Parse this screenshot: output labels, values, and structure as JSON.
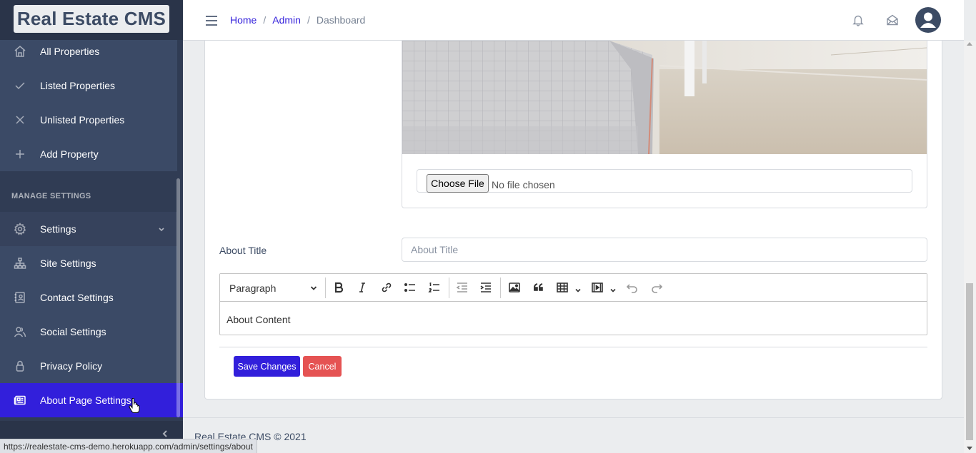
{
  "brand": "Real Estate CMS",
  "sidebar": {
    "items": [
      {
        "label": "All Properties",
        "icon": "home-icon"
      },
      {
        "label": "Listed Properties",
        "icon": "check-icon"
      },
      {
        "label": "Unlisted Properties",
        "icon": "x-icon"
      },
      {
        "label": "Add Property",
        "icon": "plus-icon"
      }
    ],
    "section_title": "MANAGE SETTINGS",
    "settings": [
      {
        "label": "Settings",
        "icon": "gear-icon"
      },
      {
        "label": "Site Settings",
        "icon": "sitemap-icon"
      },
      {
        "label": "Contact Settings",
        "icon": "contact-icon"
      },
      {
        "label": "Social Settings",
        "icon": "people-icon"
      },
      {
        "label": "Privacy Policy",
        "icon": "lock-icon"
      },
      {
        "label": "About Page Settings",
        "icon": "newspaper-icon"
      }
    ]
  },
  "header": {
    "breadcrumb": [
      "Home",
      "Admin",
      "Dashboard"
    ]
  },
  "form": {
    "file_button": "Choose File",
    "file_status": "No file chosen",
    "about_title_label": "About Title",
    "about_title_placeholder": "About Title",
    "editor_format": "Paragraph",
    "editor_content": "About Content",
    "save_label": "Save Changes",
    "cancel_label": "Cancel"
  },
  "footer": {
    "text": "Real Estate CMS © 2021"
  },
  "status_url": "https://realestate-cms-demo.herokuapp.com/admin/settings/about",
  "colors": {
    "sidebar": "#303c54",
    "primary": "#321fdb",
    "danger": "#e55353"
  }
}
